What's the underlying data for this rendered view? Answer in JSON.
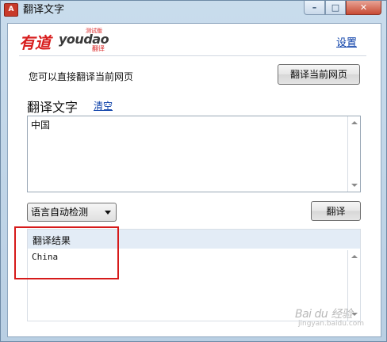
{
  "window": {
    "title": "翻译文字",
    "icon_label": "A",
    "controls": {
      "minimize": "–",
      "maximize": "□",
      "close": "✕"
    }
  },
  "logo": {
    "cn": "有道",
    "en": "youdao",
    "beta": "测试版",
    "sub": "翻译"
  },
  "header": {
    "settings_label": "设置"
  },
  "page_translate": {
    "hint": "您可以直接翻译当前网页",
    "button_label": "翻译当前网页"
  },
  "translate_text": {
    "title": "翻译文字",
    "clear_label": "清空",
    "input_value": "中国"
  },
  "controls": {
    "language_selected": "语言自动检测",
    "translate_label": "翻译"
  },
  "result": {
    "title": "翻译结果",
    "text": "China"
  },
  "watermark": {
    "text": "Bai du 经验",
    "sub": "jingyan.baidu.com"
  },
  "colors": {
    "accent_link": "#0b3fa8",
    "brand_red": "#d81e1e",
    "annotation": "#d61a1a"
  }
}
